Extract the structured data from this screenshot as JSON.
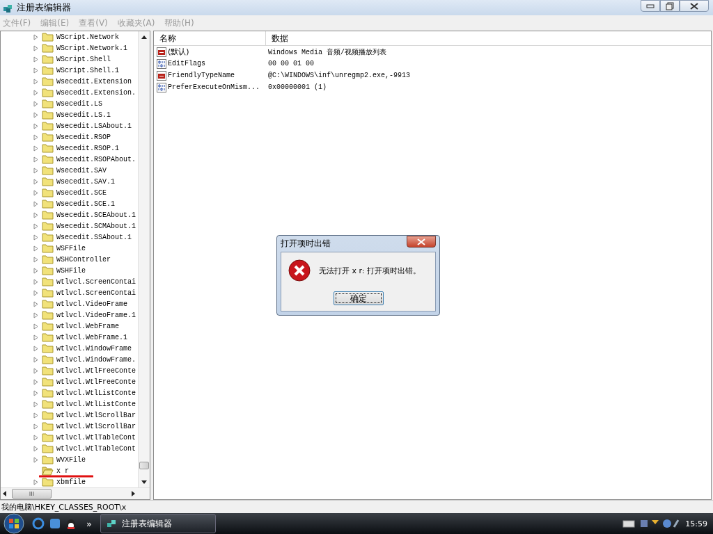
{
  "window": {
    "title": "注册表编辑器"
  },
  "menu": [
    {
      "label": "文件(F)",
      "disabled": true
    },
    {
      "label": "编辑(E)",
      "disabled": true
    },
    {
      "label": "查看(V)",
      "disabled": true
    },
    {
      "label": "收藏夹(A)",
      "disabled": true
    },
    {
      "label": "帮助(H)",
      "disabled": true
    }
  ],
  "tree": {
    "items": [
      {
        "label": "WScript.Network",
        "expandable": true,
        "open": false
      },
      {
        "label": "WScript.Network.1",
        "expandable": true,
        "open": false
      },
      {
        "label": "WScript.Shell",
        "expandable": true,
        "open": false
      },
      {
        "label": "WScript.Shell.1",
        "expandable": true,
        "open": false
      },
      {
        "label": "Wsecedit.Extension",
        "expandable": true,
        "open": false
      },
      {
        "label": "Wsecedit.Extension.",
        "expandable": true,
        "open": false
      },
      {
        "label": "Wsecedit.LS",
        "expandable": true,
        "open": false
      },
      {
        "label": "Wsecedit.LS.1",
        "expandable": true,
        "open": false
      },
      {
        "label": "Wsecedit.LSAbout.1",
        "expandable": true,
        "open": false
      },
      {
        "label": "Wsecedit.RSOP",
        "expandable": true,
        "open": false
      },
      {
        "label": "Wsecedit.RSOP.1",
        "expandable": true,
        "open": false
      },
      {
        "label": "Wsecedit.RSOPAbout.",
        "expandable": true,
        "open": false
      },
      {
        "label": "Wsecedit.SAV",
        "expandable": true,
        "open": false
      },
      {
        "label": "Wsecedit.SAV.1",
        "expandable": true,
        "open": false
      },
      {
        "label": "Wsecedit.SCE",
        "expandable": true,
        "open": false
      },
      {
        "label": "Wsecedit.SCE.1",
        "expandable": true,
        "open": false
      },
      {
        "label": "Wsecedit.SCEAbout.1",
        "expandable": true,
        "open": false
      },
      {
        "label": "Wsecedit.SCMAbout.1",
        "expandable": true,
        "open": false
      },
      {
        "label": "Wsecedit.SSAbout.1",
        "expandable": true,
        "open": false
      },
      {
        "label": "WSFFile",
        "expandable": true,
        "open": false
      },
      {
        "label": "WSHController",
        "expandable": true,
        "open": false
      },
      {
        "label": "WSHFile",
        "expandable": true,
        "open": false
      },
      {
        "label": "wtlvcl.ScreenContai",
        "expandable": true,
        "open": false
      },
      {
        "label": "wtlvcl.ScreenContai",
        "expandable": true,
        "open": false
      },
      {
        "label": "wtlvcl.VideoFrame",
        "expandable": true,
        "open": false
      },
      {
        "label": "wtlvcl.VideoFrame.1",
        "expandable": true,
        "open": false
      },
      {
        "label": "wtlvcl.WebFrame",
        "expandable": true,
        "open": false
      },
      {
        "label": "wtlvcl.WebFrame.1",
        "expandable": true,
        "open": false
      },
      {
        "label": "wtlvcl.WindowFrame",
        "expandable": true,
        "open": false
      },
      {
        "label": "wtlvcl.WindowFrame.",
        "expandable": true,
        "open": false
      },
      {
        "label": "wtlvcl.WtlFreeConte",
        "expandable": true,
        "open": false
      },
      {
        "label": "wtlvcl.WtlFreeConte",
        "expandable": true,
        "open": false
      },
      {
        "label": "wtlvcl.WtlListConte",
        "expandable": true,
        "open": false
      },
      {
        "label": "wtlvcl.WtlListConte",
        "expandable": true,
        "open": false
      },
      {
        "label": "wtlvcl.WtlScrollBar",
        "expandable": true,
        "open": false
      },
      {
        "label": "wtlvcl.WtlScrollBar",
        "expandable": true,
        "open": false
      },
      {
        "label": "wtlvcl.WtlTableCont",
        "expandable": true,
        "open": false
      },
      {
        "label": "wtlvcl.WtlTableCont",
        "expandable": true,
        "open": false
      },
      {
        "label": "WVXFile",
        "expandable": true,
        "open": false
      },
      {
        "label": "x r",
        "expandable": false,
        "open": true
      },
      {
        "label": "xbmfile",
        "expandable": true,
        "open": false
      }
    ]
  },
  "values": {
    "columns": [
      "名称",
      "数据"
    ],
    "rows": [
      {
        "kind": "string",
        "name": "(默认)",
        "data": "Windows Media 音频/视频播放列表"
      },
      {
        "kind": "binary",
        "name": "EditFlags",
        "data": "00 00 01 00"
      },
      {
        "kind": "string",
        "name": "FriendlyTypeName",
        "data": "@C:\\WINDOWS\\inf\\unregmp2.exe,-9913"
      },
      {
        "kind": "binary",
        "name": "PreferExecuteOnMism...",
        "data": "0x00000001 (1)"
      }
    ]
  },
  "status_bar": "我的电脑\\HKEY_CLASSES_ROOT\\x",
  "dialog": {
    "title": "打开项时出错",
    "message": "无法打开 x r: 打开项时出错。",
    "button": "确定"
  },
  "taskbar": {
    "chevron": "»",
    "task": "注册表编辑器",
    "clock": "15:59"
  }
}
